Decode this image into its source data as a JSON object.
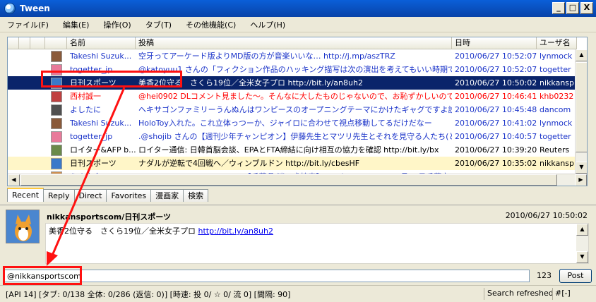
{
  "window": {
    "title": "Tween",
    "minimize": "_",
    "maximize": "□",
    "close": "X"
  },
  "menu": [
    "ファイル(F)",
    "編集(E)",
    "操作(O)",
    "タブ(T)",
    "その他機能(C)",
    "ヘルプ(H)"
  ],
  "columns": [
    "",
    "",
    "",
    "",
    "名前",
    "投稿",
    "日時",
    "ユーザ名"
  ],
  "rows": [
    {
      "name": "Takeshi Suzuk...",
      "post": "空牙ってアーケード版よりMD版の方が音楽いいな… http://j.mp/aszTRZ",
      "date": "2010/06/27 10:52:07",
      "user": "lynmock",
      "style": "blue",
      "avatar": "#8a5a3a"
    },
    {
      "name": "togetter_jp",
      "post": "@katoyuu1 さんの「フィクション作品のハッキング描写は次の演出を考えてもいい時期ではな…",
      "date": "2010/06/27 10:52:07",
      "user": "togetter",
      "style": "blue",
      "avatar": "#e87a9a"
    },
    {
      "name": "日刊スポーツ",
      "post": "美香2位守る　さくら19位／全米女子プロ http://bit.ly/an8uh2",
      "date": "2010/06/27 10:50:02",
      "user": "nikkansp",
      "style": "sel",
      "avatar": "#3a79c9"
    },
    {
      "name": "西村誠一",
      "post": "@hei0902 DLコメント見ました～。そんなに大したものじゃないので、お恥ずかしいのですが・・・",
      "date": "2010/06/27 10:46:41",
      "user": "khb0232",
      "style": "red",
      "avatar": "#c04040"
    },
    {
      "name": "よしたに",
      "post": "ヘキサゴンファミリーうんぬんはワンピースのオープニングテーマにかけたギャグですよ説明した",
      "date": "2010/06/27 10:45:48",
      "user": "dancom",
      "style": "blue",
      "avatar": "#505050"
    },
    {
      "name": "Takeshi Suzuk...",
      "post": "HoloToy入れた。これ立体っつーか、ジャイロに合わせて視点移動してるだけだなー",
      "date": "2010/06/27 10:41:02",
      "user": "lynmock",
      "style": "blue",
      "avatar": "#8a5a3a"
    },
    {
      "name": "togetter_jp",
      "post": ".@shojib さんの【週刊少年チャンピオン】伊藤先生とマツリ先生とそれを見守る人たち(とデン…",
      "date": "2010/06/27 10:40:57",
      "user": "togetter",
      "style": "blue",
      "avatar": "#e87a9a"
    },
    {
      "name": "ロイター&AFP b...",
      "post": "ロイター通信: 日韓首脳会談、EPAとFTA締結に向け相互の協力を確認 http://bit.ly/bx",
      "date": "2010/06/27 10:39:20",
      "user": "Reuters",
      "style": "black",
      "avatar": "#6a8a4a"
    },
    {
      "name": "日刊スポーツ",
      "post": "ナダルが逆転で4回戦へ／ウィンブルドン http://bit.ly/cbesHF",
      "date": "2010/06/27 10:35:02",
      "user": "nikkansp",
      "style": "hl",
      "avatar": "#3a79c9"
    },
    {
      "name": "うさ京介",
      "post": "RT @kumyu_cat: @k_usuta【千葉県/迷い犬捜索】ヨーキーMIX7kg/♂/5月26日千葉市…",
      "date": "2010/06/27 10:32:44",
      "user": "k_usuta",
      "style": "blue",
      "avatar": "#d09050"
    },
    {
      "name": "togetter_jp",
      "post": "@chicate_ta さんの「ついったーす事利 6月26日分 技者起利たせたが200RVに達しました」",
      "date": "2010/06/27 10:31:26",
      "user": "togetter",
      "style": "blue",
      "avatar": "#e87a9a"
    }
  ],
  "tabs": [
    "Recent",
    "Reply",
    "Direct",
    "Favorites",
    "漫画家",
    "検索"
  ],
  "detail": {
    "name": "nikkansportscom/日刊スポーツ",
    "date": "2010/06/27 10:50:02",
    "text": "美香2位守る　さくら19位／全米女子プロ ",
    "link": "http://bit.ly/an8uh2"
  },
  "input": {
    "value": "@nikkansportscom ",
    "count": "123",
    "post_label": "Post"
  },
  "status": {
    "text": "[API 14] [タブ: 0/138 全体: 0/286 (返信: 0)] [時速: 投 0/ ☆ 0/ 流 0] [間隔: 90]",
    "right": "Search refreshed",
    "mode": "#[-]"
  }
}
